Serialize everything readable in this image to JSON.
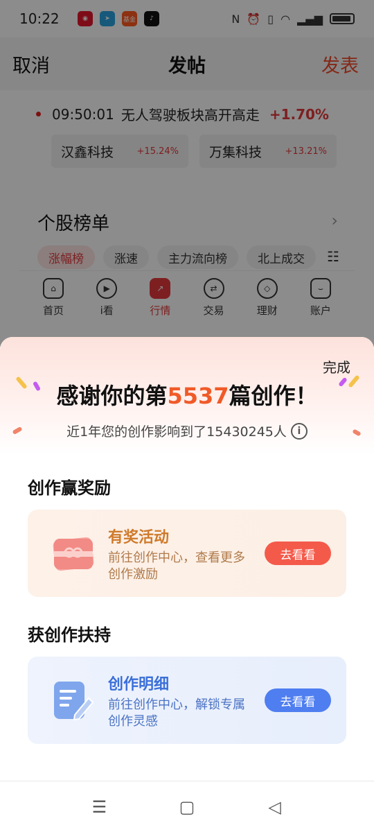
{
  "status_bar": {
    "time": "10:22",
    "apps": [
      {
        "icon": "weibo-icon",
        "color": "#e6162d",
        "label": ""
      },
      {
        "icon": "telegram-icon",
        "color": "#2aa3e0",
        "label": ""
      },
      {
        "icon": "fund-app-icon",
        "color": "#ff5a1f",
        "label": "基金"
      },
      {
        "icon": "tiktok-icon",
        "color": "#111111",
        "label": ""
      }
    ]
  },
  "topbar": {
    "cancel": "取消",
    "title": "发帖",
    "publish": "发表"
  },
  "news": {
    "time": "09:50:01",
    "headline": "无人驾驶板块高开高走",
    "change": "+1.70%",
    "stocks": [
      {
        "name": "汉鑫科技",
        "change": "+15.24%"
      },
      {
        "name": "万集科技",
        "change": "+13.21%"
      }
    ]
  },
  "ranking": {
    "title": "个股榜单",
    "tabs": [
      "涨幅榜",
      "涨速",
      "主力流向榜",
      "北上成交"
    ]
  },
  "tabbar": {
    "items": [
      {
        "label": "首页",
        "icon": "home-icon"
      },
      {
        "label": "i看",
        "icon": "play-icon"
      },
      {
        "label": "行情",
        "icon": "market-icon"
      },
      {
        "label": "交易",
        "icon": "trade-icon"
      },
      {
        "label": "理财",
        "icon": "finance-icon"
      },
      {
        "label": "账户",
        "icon": "account-icon"
      }
    ]
  },
  "sheet": {
    "done": "完成",
    "thanks_prefix": "感谢你的第",
    "thanks_number": "5537",
    "thanks_suffix": "篇创作！",
    "impact": "近1年您的创作影响到了15430245人",
    "section1": "创作赢奖励",
    "card1": {
      "title": "有奖活动",
      "desc": "前往创作中心，查看更多创作激励",
      "button": "去看看",
      "icon": "gift-ticket-icon"
    },
    "section2": "获创作扶持",
    "card2": {
      "title": "创作明细",
      "desc": "前往创作中心，解锁专属创作灵感",
      "button": "去看看",
      "icon": "document-edit-icon"
    }
  },
  "colors": {
    "accent_red": "#e4393c",
    "accent_orange": "#f05a28",
    "button_red": "#f45a4a",
    "button_blue": "#4f7ef0"
  }
}
